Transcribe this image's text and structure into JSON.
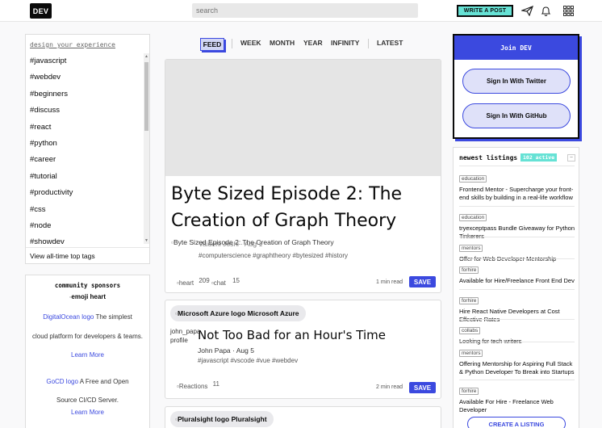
{
  "topbar": {
    "logo": "DEV",
    "search_placeholder": "search",
    "write_post": "WRITE A POST",
    "icons": [
      "send-icon",
      "bell-icon",
      "apps-grid-icon"
    ]
  },
  "sidebar": {
    "header": "design your experience",
    "tags": [
      "#javascript",
      "#webdev",
      "#beginners",
      "#discuss",
      "#react",
      "#python",
      "#career",
      "#tutorial",
      "#productivity",
      "#css",
      "#node",
      "#showdev"
    ],
    "footer": "View all-time top tags"
  },
  "sponsors": {
    "title": "community sponsors",
    "emoji_alt": "emoji heart",
    "items": [
      {
        "logo_alt": "DigitalOcean logo",
        "text_a": "The simplest",
        "text_b": "cloud platform for developers & teams.",
        "link": "Learn More"
      },
      {
        "logo_alt": "GoCD logo",
        "text_a": "A Free and Open",
        "text_b": "Source CI/CD Server.",
        "link": "Learn More"
      }
    ]
  },
  "feed_nav": {
    "active": "FEED",
    "items": [
      "WEEK",
      "MONTH",
      "YEAR",
      "INFINITY",
      "LATEST"
    ]
  },
  "featured": {
    "title": "Byte Sized Episode 2: The Creation of Graph Theory",
    "img_alt": "Byte Sized Episode 2: The Creation of Graph Theory",
    "author": "Vaidehi Joshi · Aug 1",
    "tags": "#computerscience  #graphtheory  #bytesized  #history",
    "heart_alt": "heart",
    "hearts": "209",
    "chat_alt": "chat",
    "comments": "15",
    "read_time": "1 min read",
    "save": "SAVE"
  },
  "post2": {
    "org_alt": "Microsoft Azure logo",
    "org": "Microsoft Azure",
    "avatar_alt": "john_papa profile",
    "title": "Not Too Bad for an Hour's Time",
    "author": "John Papa · Aug 5",
    "tags": "#javascript  #vscode  #vue  #webdev",
    "reactions_alt": "Reactions",
    "reactions": "11",
    "read_time": "2 min read",
    "save": "SAVE"
  },
  "post3": {
    "org_alt": "Pluralsight logo",
    "org": "Pluralsight"
  },
  "join": {
    "title": "Join DEV",
    "twitter": "Sign In With Twitter",
    "github": "Sign In With GitHub"
  },
  "listings": {
    "title": "newest listings",
    "count": "102 active",
    "items": [
      {
        "cat": "education",
        "title": "Frontend Mentor - Supercharge your front-end skills by building in a real-life workflow"
      },
      {
        "cat": "education",
        "title": "tryexceptpass Bundle Giveaway for Python Tinkerers"
      },
      {
        "cat": "mentors",
        "title": "Offer for Web Developer Mentorship"
      },
      {
        "cat": "forhire",
        "title": "Available for Hire/Freelance Front End Dev"
      },
      {
        "cat": "forhire",
        "title": "Hire React Native Developers at Cost Effective Rates"
      },
      {
        "cat": "collabs",
        "title": "Looking for tech writers"
      },
      {
        "cat": "mentors",
        "title": "Offering Mentorship for Aspiring Full Stack & Python Developer To Break into Startups"
      },
      {
        "cat": "forhire",
        "title": "Available For Hire - Freelance Web Developer"
      }
    ],
    "create": "CREATE A LISTING"
  }
}
